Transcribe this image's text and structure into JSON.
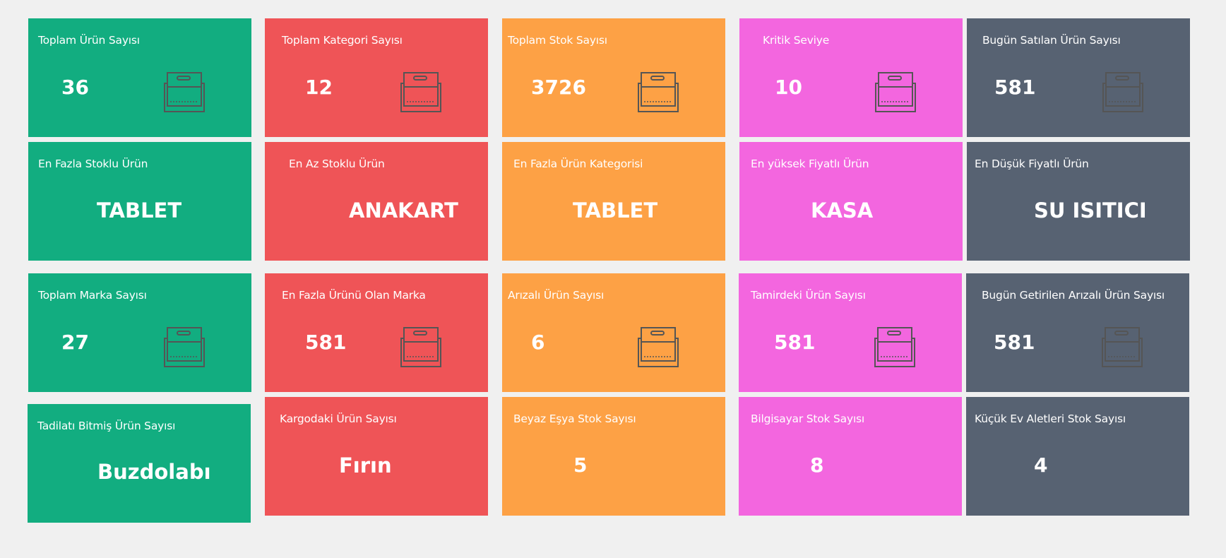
{
  "colors": {
    "green": "#12ad80",
    "red": "#ef5457",
    "orange": "#fda145",
    "pink": "#f366df",
    "slate": "#576272",
    "icon_stroke": "#555555"
  },
  "icon_name": "inbox-icon",
  "row1": {
    "total_products": {
      "title": "Toplam Ürün Sayısı",
      "value": "36"
    },
    "total_categories": {
      "title": "Toplam Kategori Sayısı",
      "value": "12"
    },
    "total_stock": {
      "title": "Toplam Stok Sayısı",
      "value": "3726"
    },
    "critical_level": {
      "title": "Kritik Seviye",
      "value": "10"
    },
    "sold_today": {
      "title": "Bugün Satılan Ürün Sayısı",
      "value": "581"
    }
  },
  "row2": {
    "most_stocked": {
      "title": "En Fazla Stoklu Ürün",
      "value": "TABLET"
    },
    "least_stocked": {
      "title": "En Az Stoklu Ürün",
      "value": "ANAKART"
    },
    "top_category": {
      "title": "En Fazla Ürün Kategorisi",
      "value": "TABLET"
    },
    "highest_price": {
      "title": "En yüksek Fiyatlı Ürün",
      "value": "KASA"
    },
    "lowest_price": {
      "title": "En Düşük Fiyatlı Ürün",
      "value": "SU ISITICI"
    }
  },
  "row3": {
    "total_brands": {
      "title": "Toplam Marka Sayısı",
      "value": "27"
    },
    "top_brand": {
      "title": "En Fazla Ürünü Olan Marka",
      "value": "581"
    },
    "faulty": {
      "title": "Arızalı Ürün Sayısı",
      "value": "6"
    },
    "in_repair": {
      "title": "Tamirdeki Ürün Sayısı",
      "value": "581"
    },
    "faulty_today": {
      "title": "Bugün Getirilen Arızalı Ürün Sayısı",
      "value": "581"
    }
  },
  "row4": {
    "repair_done": {
      "title": "Tadilatı Bitmiş Ürün Sayısı",
      "value": "Buzdolabı"
    },
    "in_cargo": {
      "title": "Kargodaki Ürün Sayısı",
      "value": "Fırın"
    },
    "white_goods": {
      "title": "Beyaz Eşya Stok Sayısı",
      "value": "5"
    },
    "computer": {
      "title": "Bilgisayar Stok Sayısı",
      "value": "8"
    },
    "small_appliances": {
      "title": "Küçük Ev Aletleri Stok Sayısı",
      "value": "4"
    }
  }
}
